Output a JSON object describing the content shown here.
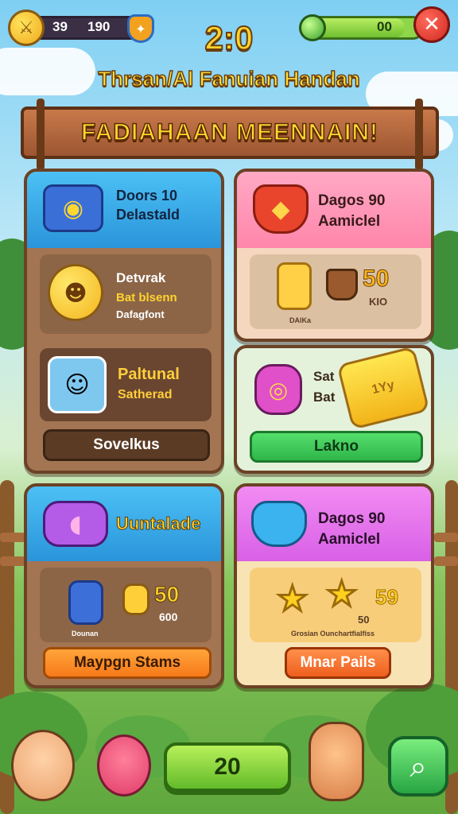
{
  "top_bar": {
    "coins_a": "39",
    "coins_b": "190",
    "hp_value": "00",
    "hp_fraction": 0.85,
    "coin_icon": "sword-coin-icon",
    "shield_icon": "shield-icon",
    "gem_icon": "green-gem-icon",
    "close_icon": "close-icon"
  },
  "score": "2:0",
  "subtitle": "Thrsan/Al Fanuian Handan",
  "banner": "FADIAHAAN MEENNAIN!",
  "cards": {
    "c1": {
      "head_line1": "Doors 10",
      "head_line2": "Delastald",
      "row1_line1": "Detvrak",
      "row1_line2": "Bat blsenn",
      "row1_line3": "Dafagfont",
      "row2_line1": "Paltunal",
      "row2_line2": "Satherad",
      "button": "Sovelkus"
    },
    "c2": {
      "head_line1": "Dagos 90",
      "head_line2": "Aamiclel",
      "value": "50",
      "sub_value": "KIO",
      "small_label": "DAlKa"
    },
    "c3": {
      "line1": "Sat",
      "line2": "Bat",
      "ticket_text": "1Yy",
      "button": "Lakno"
    },
    "c4": {
      "head_title": "Uuntalade",
      "value": "50",
      "sub_value": "600",
      "small_label": "Dounan",
      "button": "Maypgn Stams"
    },
    "c5": {
      "head_line1": "Dagos 90",
      "head_line2": "Aamiclel",
      "star_value": "59",
      "star_sub": "50",
      "small_label": "Grosian Ounchartfialfiss",
      "button": "Mnar Pails"
    }
  },
  "bottom": {
    "center_value": "20",
    "search_icon": "magnifier-icon"
  },
  "colors": {
    "blue_head": "#35a9ea",
    "pink_head": "#ff8fb1",
    "magenta_head": "#e66cf0",
    "green_button": "#3fcf55",
    "orange_button": "#ff8a1f",
    "brown_panel": "#8a6245"
  }
}
